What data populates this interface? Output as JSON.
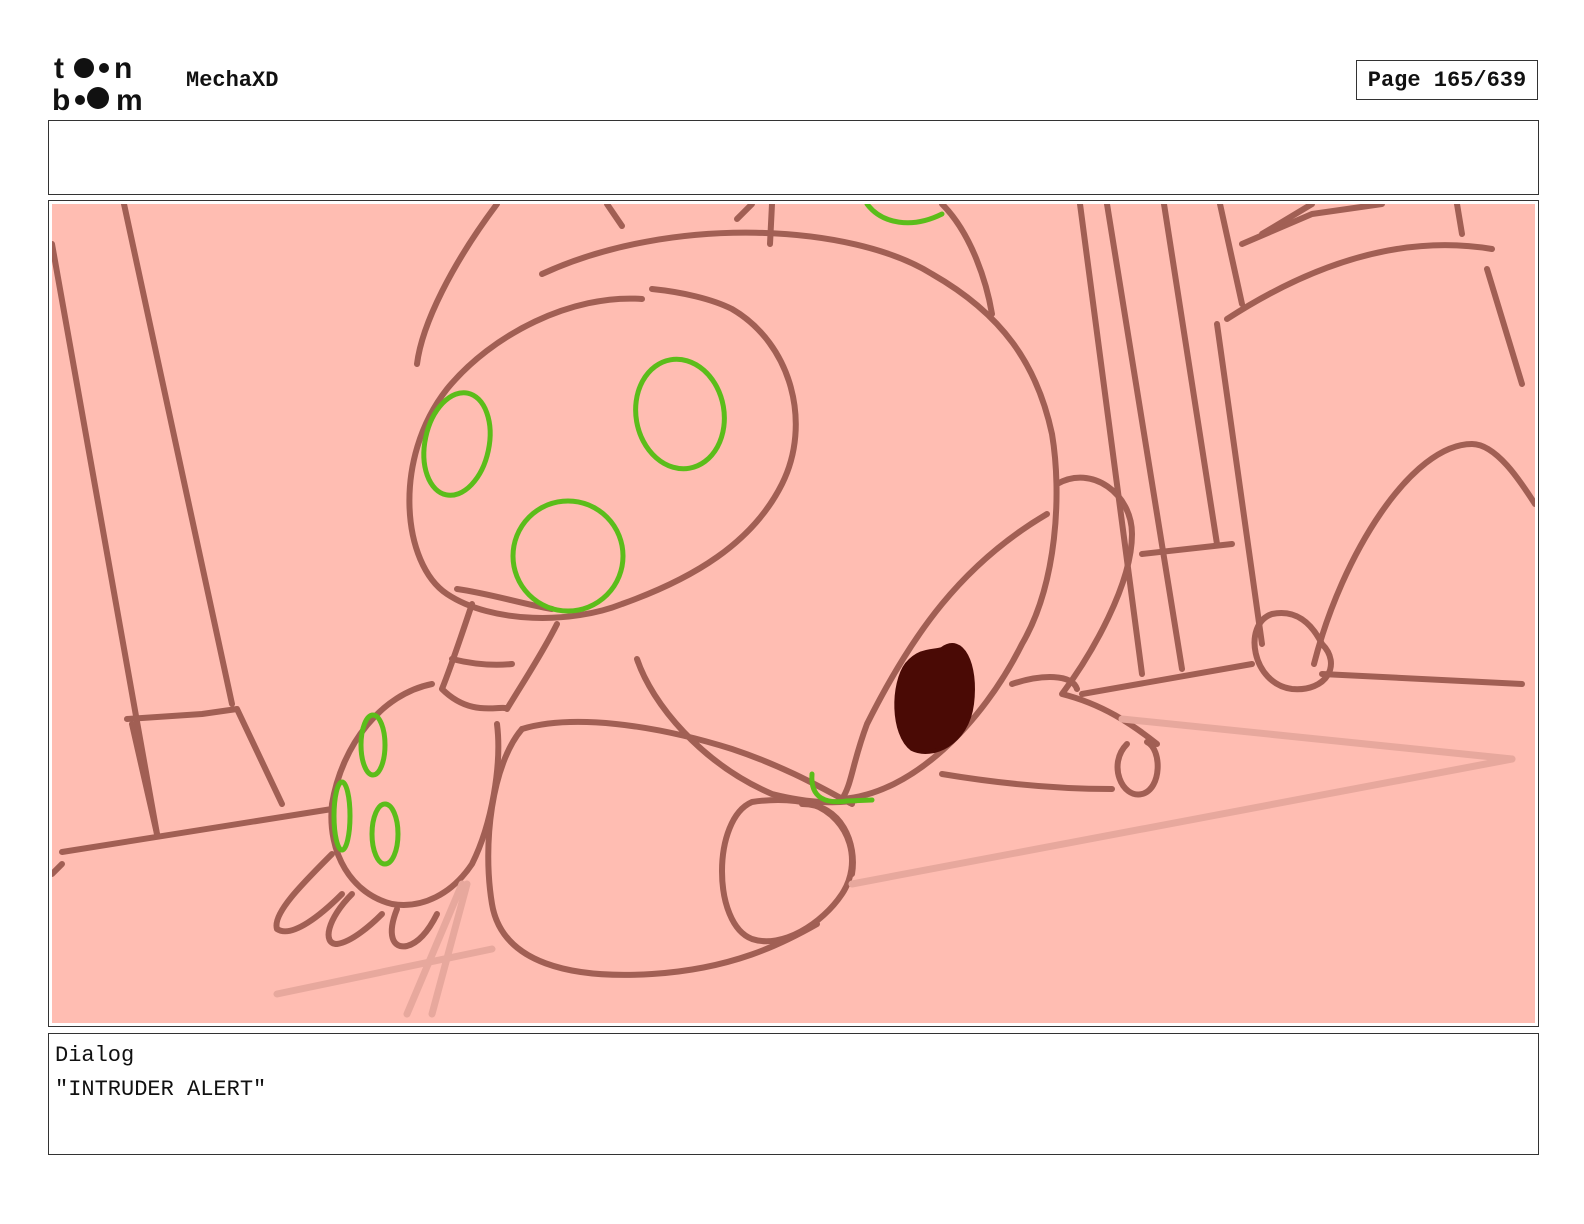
{
  "header": {
    "logo_text": "toon boom",
    "project_title": "MechaXD",
    "page_label": "Page 165/639"
  },
  "panel": {
    "notes": "",
    "dialog_label": "Dialog",
    "dialog_text": "\"INTRUDER ALERT\""
  },
  "colors": {
    "panel_background": "#ffbdb2",
    "line_color": "#a15f54",
    "eye_color": "#5bbd1a",
    "dark_accent": "#4a0a05"
  }
}
